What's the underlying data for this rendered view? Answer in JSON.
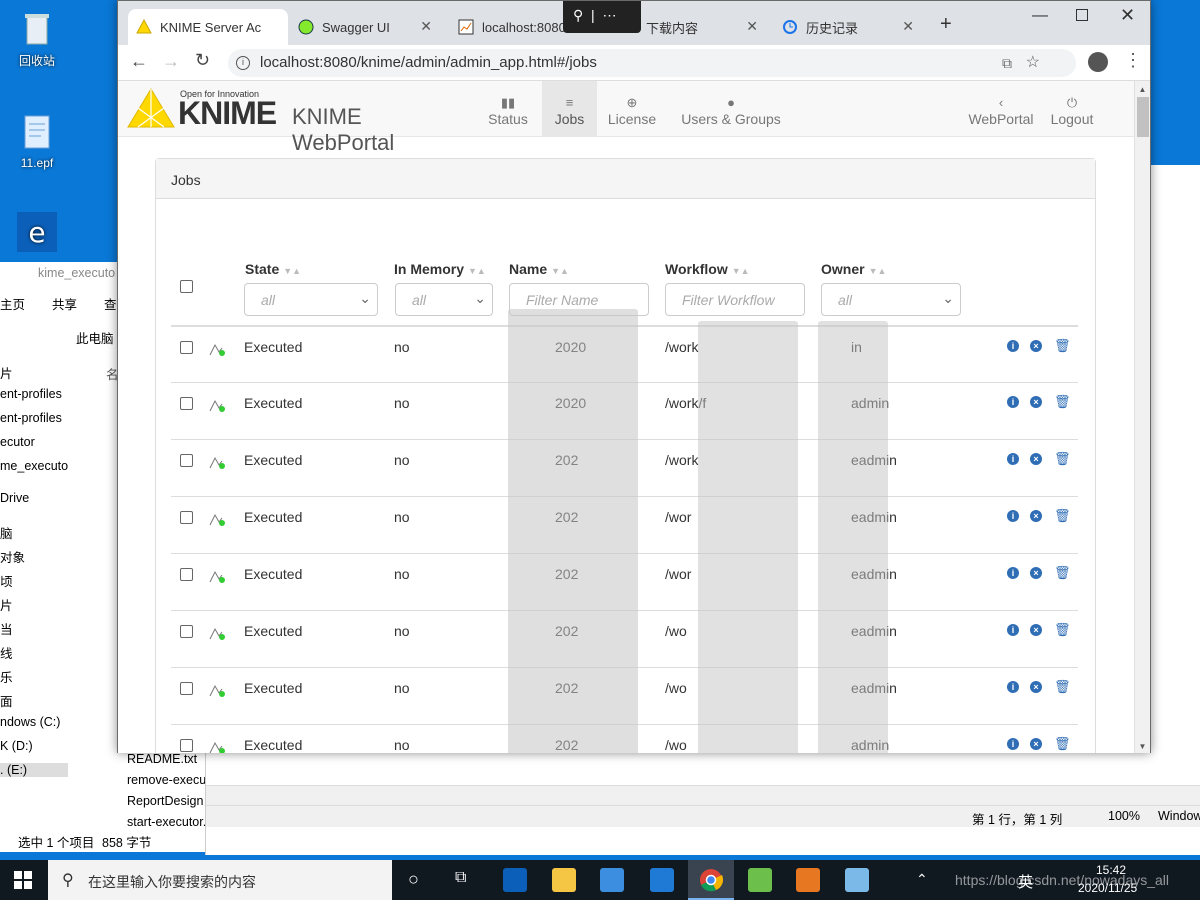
{
  "desktop": {
    "icons": [
      {
        "label": "回收站",
        "icon": "recycle-bin-icon"
      },
      {
        "label": "11.epf",
        "icon": "document-icon"
      },
      {
        "label": "",
        "icon": "edge-icon"
      }
    ]
  },
  "explorer": {
    "header_path": "kime_executo",
    "ribbon": [
      "主页",
      "共享",
      "查"
    ],
    "address": "此电脑",
    "nav_items": [
      "片",
      "ent-profiles",
      "ent-profiles",
      "ecutor",
      "me_executo",
      "Drive",
      "脑",
      "对象",
      "顷",
      "片",
      "当",
      "线",
      "乐",
      "面",
      "ndows (C:)",
      "K (D:)",
      ". (E:)"
    ],
    "files": [
      "README.txt",
      "remove-execu",
      "ReportDesign",
      "start-executor.bat"
    ],
    "column_header": "名",
    "status": {
      "selected": "选中 1 个项目",
      "size": "858 字节"
    }
  },
  "notepad": {
    "status": {
      "position": "第 1 行，第 1 列",
      "zoom": "100%",
      "encoding": "Window"
    }
  },
  "chrome": {
    "tabs": [
      {
        "title": "KNIME Server Ac",
        "icon": "knime-warning-icon",
        "active": true
      },
      {
        "title": "Swagger UI",
        "icon": "swagger-icon",
        "active": false
      },
      {
        "title": "localhost:8080",
        "icon": "chart-icon",
        "active": false
      },
      {
        "title": "下载内容",
        "icon": "download-icon",
        "active": false
      },
      {
        "title": "历史记录",
        "icon": "history-icon",
        "active": false
      }
    ],
    "url": "localhost:8080/knime/admin/admin_app.html#/jobs"
  },
  "portal": {
    "logo": {
      "tagline": "Open for Innovation",
      "brand": "KNIME",
      "product": "KNIME WebPortal"
    },
    "nav": [
      {
        "label": "Status",
        "icon": "bar-chart-icon"
      },
      {
        "label": "Jobs",
        "icon": "server-icon",
        "active": true
      },
      {
        "label": "License",
        "icon": "upload-icon"
      },
      {
        "label": "Users & Groups",
        "icon": "user-icon"
      }
    ],
    "nav_right": [
      {
        "label": "WebPortal",
        "icon": "chevron-left-icon"
      },
      {
        "label": "Logout",
        "icon": "power-icon"
      }
    ],
    "panel_title": "Jobs",
    "columns": {
      "state": "State",
      "in_memory": "In Memory",
      "name": "Name",
      "workflow": "Workflow",
      "owner": "Owner"
    },
    "filters": {
      "state": "all",
      "in_memory": "all",
      "name": "Filter Name",
      "workflow": "Filter Workflow",
      "owner": "all"
    },
    "rows": [
      {
        "state": "Executed",
        "in_memory": "no",
        "name": "2020",
        "workflow": "/work",
        "owner": "in"
      },
      {
        "state": "Executed",
        "in_memory": "no",
        "name": "2020",
        "workflow": "/work/f",
        "owner": "admin"
      },
      {
        "state": "Executed",
        "in_memory": "no",
        "name": "202",
        "workflow": "/work",
        "owner": "eadmin"
      },
      {
        "state": "Executed",
        "in_memory": "no",
        "name": "202",
        "workflow": "/wor",
        "owner": "eadmin"
      },
      {
        "state": "Executed",
        "in_memory": "no",
        "name": "202",
        "workflow": "/wor",
        "owner": "eadmin"
      },
      {
        "state": "Executed",
        "in_memory": "no",
        "name": "202",
        "workflow": "/wo",
        "owner": "eadmin"
      },
      {
        "state": "Executed",
        "in_memory": "no",
        "name": "202",
        "workflow": "/wo",
        "owner": "eadmin"
      },
      {
        "state": "Executed",
        "in_memory": "no",
        "name": "202",
        "workflow": "/wo",
        "owner": "admin"
      }
    ]
  },
  "taskbar": {
    "search_placeholder": "在这里输入你要搜索的内容",
    "time": "15:42",
    "date": "2020/11/25",
    "ime": "英",
    "watermark": "https://blog.csdn.net/nowadays_all"
  },
  "colors": {
    "accent": "#ffd800",
    "link": "#2f6db5",
    "desktop": "#0a78d7"
  }
}
